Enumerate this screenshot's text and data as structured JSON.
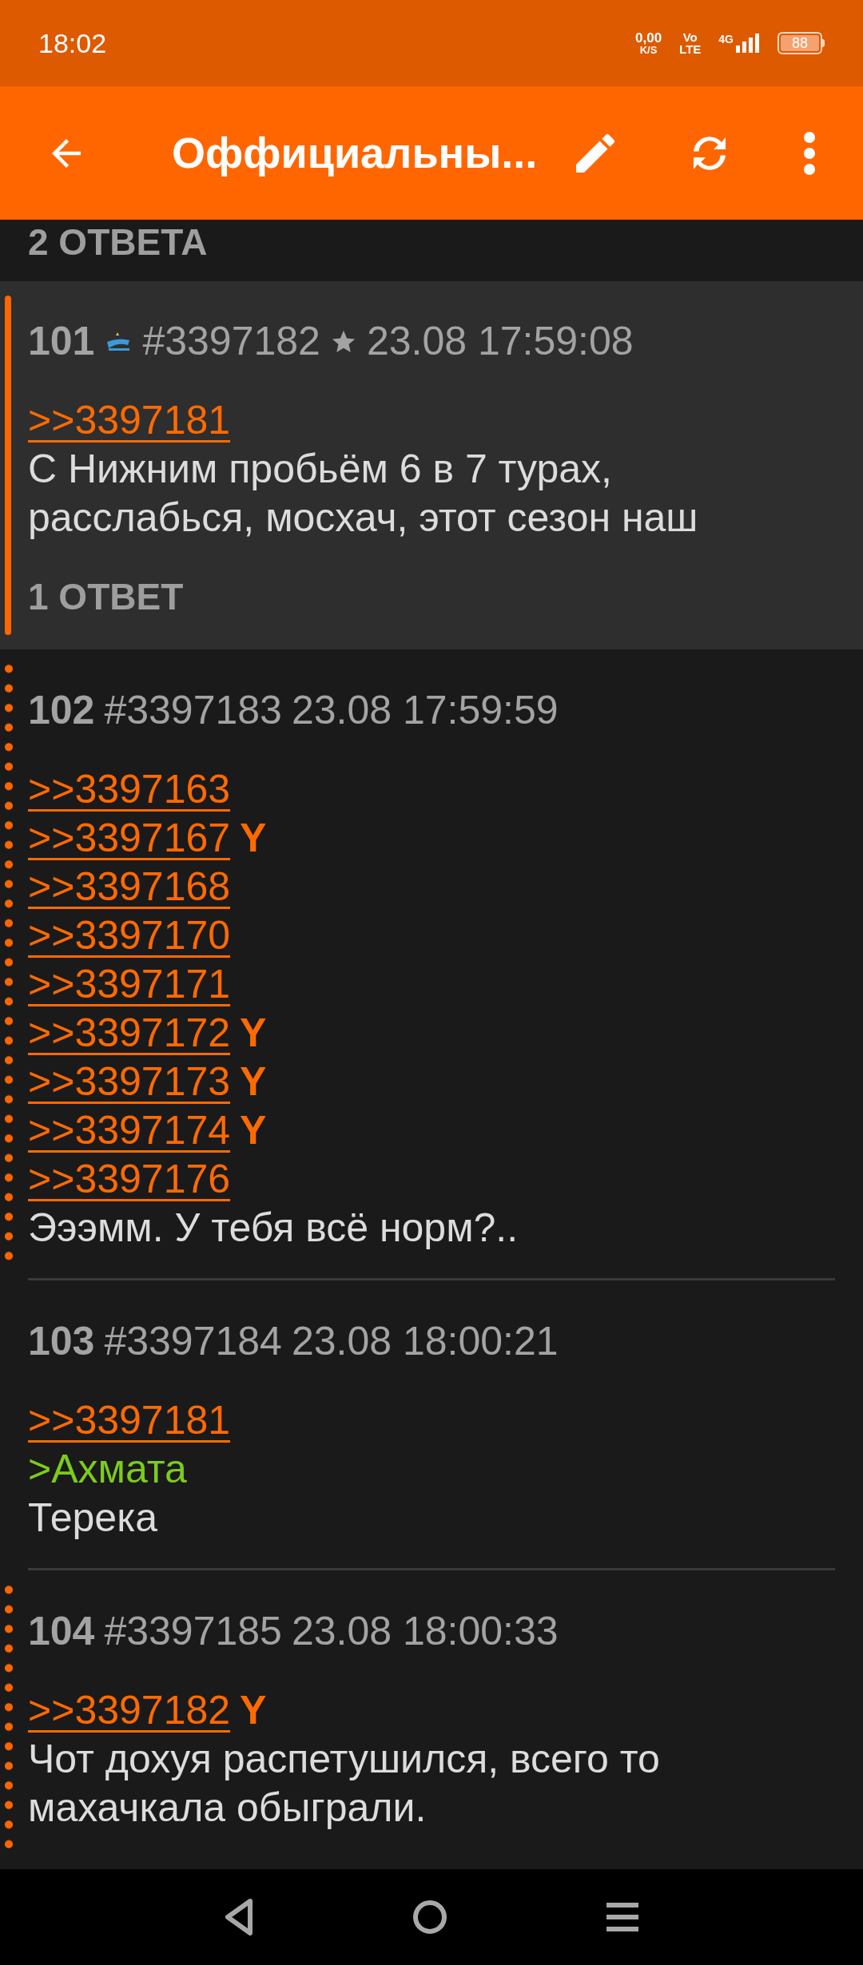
{
  "status_bar": {
    "time": "18:02",
    "speed_value": "0,00",
    "speed_unit": "K/S",
    "volte_top": "Vo",
    "volte_bottom": "LTE",
    "network": "4G",
    "battery": "88"
  },
  "app_bar": {
    "title": "Оффициальны..."
  },
  "cut_off_replies": "2 ОТВЕТА",
  "posts": [
    {
      "kind": "highlighted",
      "number": "101",
      "has_emblem": true,
      "post_id": "#3397182",
      "starred": true,
      "date": "23.08 17:59:08",
      "body": [
        {
          "kind": "link",
          "text": ">>3397181"
        },
        {
          "kind": "text",
          "text": "С Нижним пробьём 6 в 7 турах, расслабься, мосхач, этот сезон наш"
        }
      ],
      "replies": "1 ОТВЕТ"
    },
    {
      "kind": "reply",
      "number": "102",
      "has_emblem": false,
      "post_id": "#3397183",
      "starred": false,
      "date": "23.08 17:59:59",
      "body": [
        {
          "kind": "link",
          "text": ">>3397163"
        },
        {
          "kind": "link",
          "text": ">>3397167",
          "mark": "Y"
        },
        {
          "kind": "link",
          "text": ">>3397168"
        },
        {
          "kind": "link",
          "text": ">>3397170"
        },
        {
          "kind": "link",
          "text": ">>3397171"
        },
        {
          "kind": "link",
          "text": ">>3397172",
          "mark": "Y"
        },
        {
          "kind": "link",
          "text": ">>3397173",
          "mark": "Y"
        },
        {
          "kind": "link",
          "text": ">>3397174",
          "mark": "Y"
        },
        {
          "kind": "link",
          "text": ">>3397176"
        },
        {
          "kind": "text",
          "text": "Эээмм. У тебя всё норм?.."
        }
      ]
    },
    {
      "kind": "plain",
      "number": "103",
      "has_emblem": false,
      "post_id": "#3397184",
      "starred": false,
      "date": "23.08 18:00:21",
      "body": [
        {
          "kind": "link",
          "text": ">>3397181"
        },
        {
          "kind": "quote",
          "text": ">Ахмата"
        },
        {
          "kind": "text",
          "text": "Терека"
        }
      ]
    },
    {
      "kind": "reply",
      "number": "104",
      "has_emblem": false,
      "post_id": "#3397185",
      "starred": false,
      "date": "23.08 18:00:33",
      "body": [
        {
          "kind": "link",
          "text": ">>3397182",
          "mark": "Y"
        },
        {
          "kind": "text",
          "text": "Чот дохуя распетушился, всего то махачкала обыграли."
        }
      ]
    }
  ]
}
